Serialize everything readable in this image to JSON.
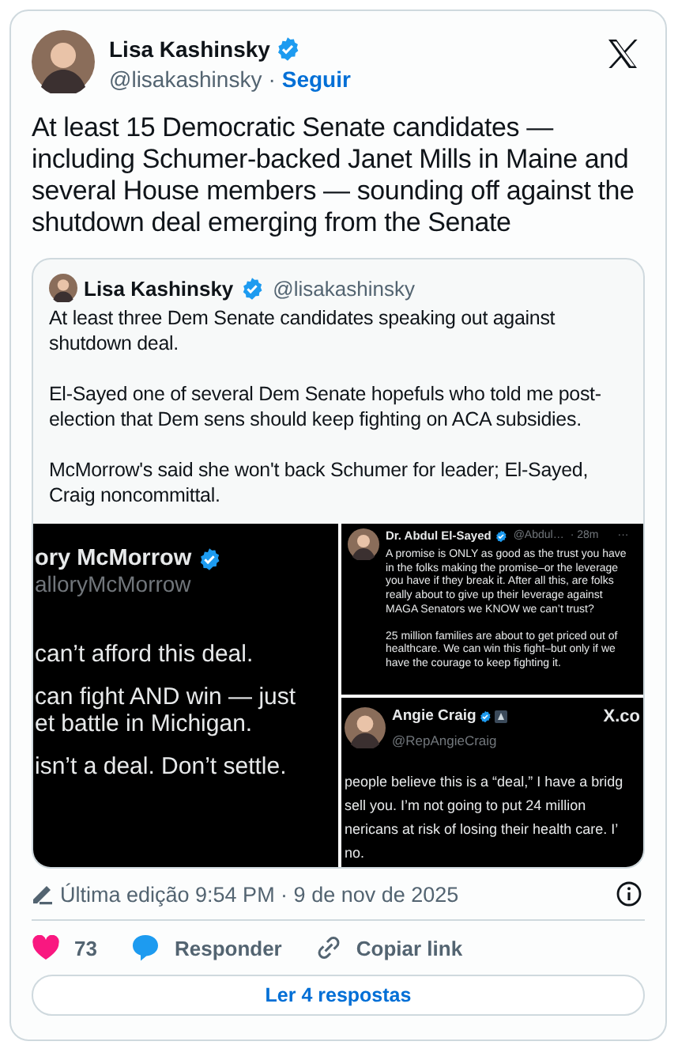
{
  "tweet": {
    "author": {
      "name": "Lisa Kashinsky",
      "verified": true,
      "handle": "@lisakashinsky",
      "dot": "·",
      "follow": "Seguir"
    },
    "text": "At least 15 Democratic Senate candidates — including Schumer-backed Janet Mills in Maine and several House members — sounding off against the shutdown deal emerging from the Senate"
  },
  "quote": {
    "author": {
      "name": "Lisa Kashinsky",
      "verified": true,
      "handle": "@lisakashinsky"
    },
    "paragraphs": [
      "At least three Dem Senate candidates speaking out against shutdown deal.",
      "El-Sayed one of several Dem Senate hopefuls who told me post-election that Dem sens should keep fighting on ACA subsidies.",
      "McMorrow's said she won't back Schumer for leader; El-Sayed, Craig noncommittal."
    ],
    "media": [
      {
        "kind": "cropped",
        "name": "ory McMorrow",
        "verified": true,
        "handle": "alloryMcMorrow",
        "blocks": [
          [
            "can’t afford this deal."
          ],
          [
            "can fight AND win — just",
            "et battle in Michigan."
          ],
          [
            "isn’t a deal. Don’t settle."
          ]
        ]
      },
      {
        "kind": "reply",
        "name": "Dr. Abdul El-Sayed",
        "verified": true,
        "handle": "@Abdul…",
        "meta": "· 28m",
        "more": "···",
        "blocks": [
          [
            "A promise is ONLY as good as the trust you have in the folks making the promise–or the leverage you have if they break it. After all this, are folks really about to give up their leverage against MAGA Senators we KNOW we can’t trust?"
          ],
          [
            "25 million families are about to get priced out of healthcare. We can win this fight–but only if we have the courage to keep fighting it."
          ]
        ]
      },
      {
        "kind": "post",
        "name": "Angie Craig",
        "verified": true,
        "affiliate": true,
        "handle": "@RepAngieCraig",
        "source": "X.co",
        "blocks": [
          [
            "people believe this is a “deal,” I have a bridg",
            "sell you. I’m not going to put 24 million",
            "nericans at risk of losing their health care. I’",
            "no."
          ]
        ]
      }
    ]
  },
  "footer": {
    "edited": "Última edição 9:54 PM · 9 de nov de 2025",
    "likes": "73",
    "reply": "Responder",
    "copy_link": "Copiar link",
    "read_replies": "Ler 4 respostas"
  }
}
